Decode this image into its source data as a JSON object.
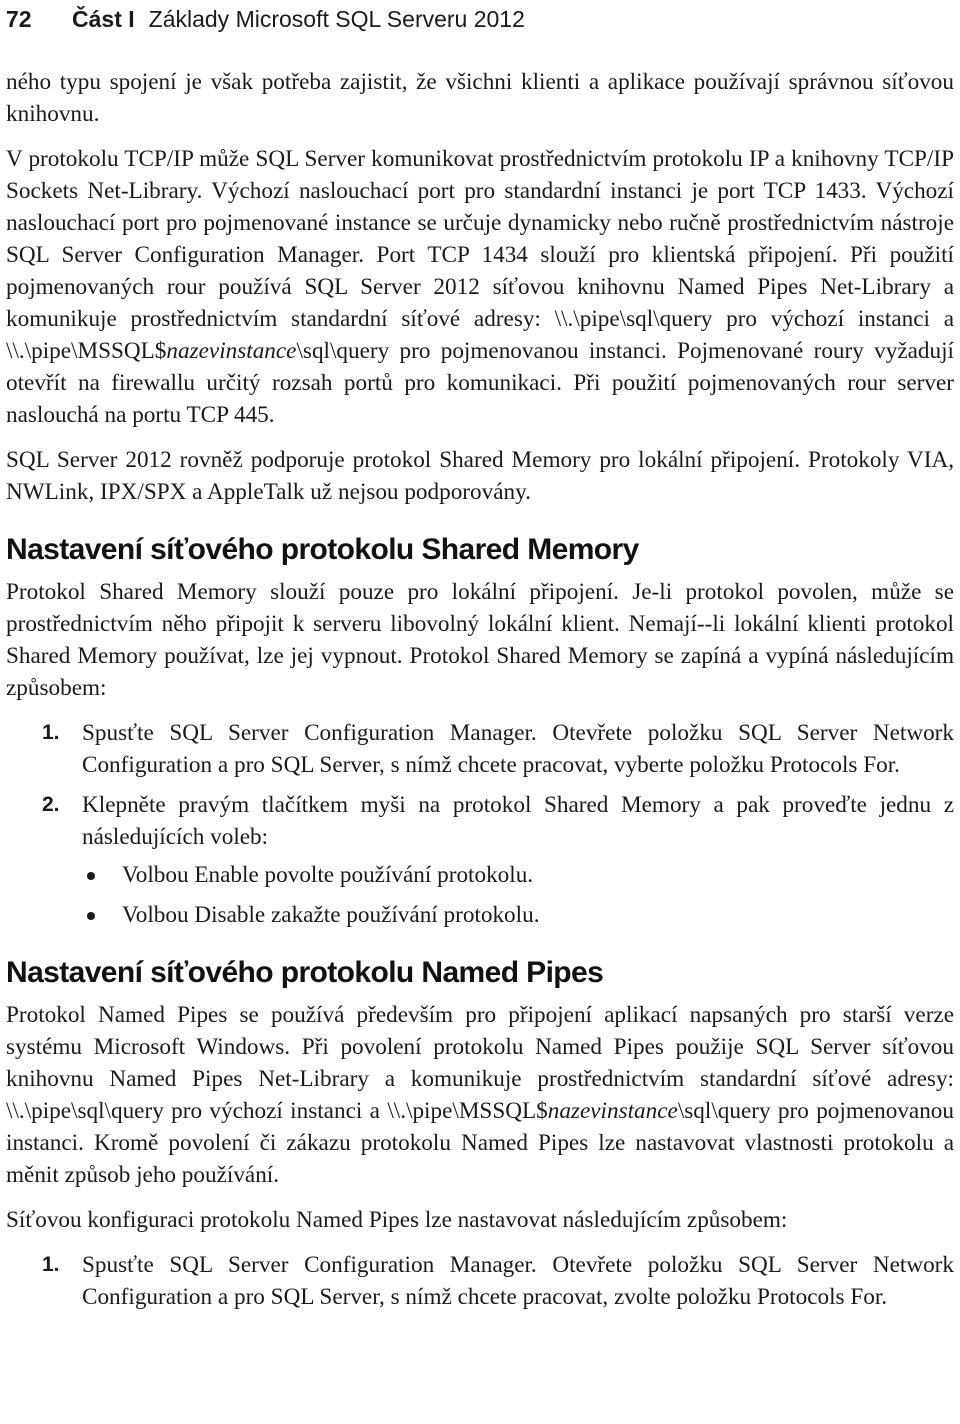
{
  "header": {
    "page_number": "72",
    "part": "Část I",
    "book_title": "Základy Microsoft SQL Serveru 2012"
  },
  "paragraphs": {
    "p1": "ného typu spojení je však potřeba zajistit, že všichni klienti a aplikace používají správnou síťovou knihovnu.",
    "p2_a": "V protokolu TCP/IP může SQL Server komunikovat prostřednictvím protokolu IP a knihovny TCP/IP Sockets Net-Library. Výchozí naslouchací port pro standardní instanci je port TCP 1433. Výchozí naslouchací port pro pojmenované instance se určuje dynamicky nebo ručně prostřednictvím nástroje SQL Server Configuration Manager. Port TCP 1434 slouží pro klientská připojení. Při použití pojmenovaných rour používá SQL Server 2012 síťovou knihovnu Named Pipes Net-Library a komunikuje prostřednictvím standardní síťové adresy: \\\\.\\pipe\\sql\\query pro výchozí instanci a \\\\.\\pipe\\MSSQL$",
    "p2_italic": "nazevinstance",
    "p2_b": "\\sql\\query pro pojmenovanou instanci. Pojmenované roury vyžadují otevřít na firewallu určitý rozsah portů pro komunikaci. Při použití pojmenovaných rour server naslouchá na portu TCP 445.",
    "p3": "SQL Server 2012 rovněž podporuje protokol Shared Memory pro lokální připojení. Protokoly VIA, NWLink, IPX/SPX a AppleTalk už nejsou podporovány."
  },
  "section_shared_memory": {
    "heading": "Nastavení síťového protokolu Shared Memory",
    "intro": "Protokol Shared Memory slouží pouze pro lokální připojení. Je-li protokol povolen, může se prostřednictvím něho připojit k serveru libovolný lokální klient. Nemají--li lokální klienti protokol Shared Memory používat, lze jej vypnout. Protokol Shared Memory se zapíná a vypíná následujícím způsobem:",
    "steps": [
      {
        "number": "1.",
        "text": "Spusťte SQL Server Configuration Manager. Otevřete položku SQL Server Network Configuration a pro SQL Server, s nímž chcete pracovat, vyberte položku Protocols For."
      },
      {
        "number": "2.",
        "text": "Klepněte pravým tlačítkem myši na protokol Shared Memory a pak proveďte jednu z následujících voleb:"
      }
    ],
    "bullets": [
      "Volbou Enable povolte používání protokolu.",
      "Volbou Disable zakažte používání protokolu."
    ]
  },
  "section_named_pipes": {
    "heading": "Nastavení síťového protokolu Named Pipes",
    "intro_a": "Protokol Named Pipes se používá především pro připojení aplikací napsaných pro starší verze systému Microsoft Windows. Při povolení protokolu Named Pipes použije SQL Server síťovou knihovnu Named Pipes Net-Library a komunikuje prostřednictvím standardní síťové adresy: \\\\.\\pipe\\sql\\query pro výchozí instanci a \\\\.\\pipe\\MSSQL$",
    "intro_italic": "nazevinstance",
    "intro_b": "\\sql\\query pro pojmenovanou instanci. Kromě povolení či zákazu protokolu Named Pipes lze nastavovat vlastnosti protokolu a měnit způsob jeho používání.",
    "config_intro": "Síťovou konfiguraci protokolu Named Pipes lze nastavovat následujícím způsobem:",
    "steps": [
      {
        "number": "1.",
        "text": "Spusťte SQL Server Configuration Manager. Otevřete položku SQL Server Network Configuration a pro SQL Server, s nímž chcete pracovat, zvolte položku Protocols For."
      }
    ]
  }
}
